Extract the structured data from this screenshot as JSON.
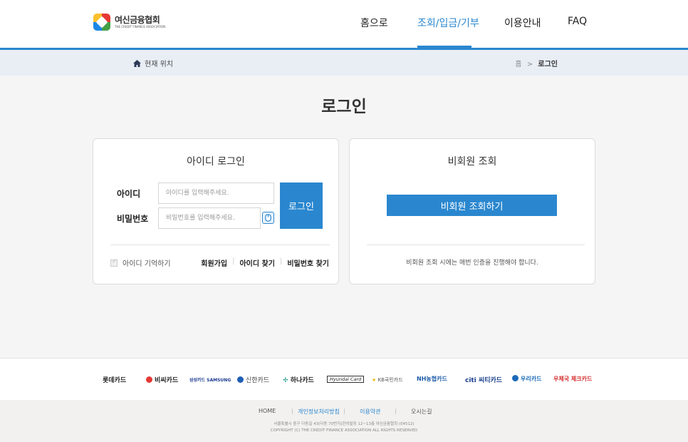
{
  "header": {
    "logo_ko": "여신금융협회",
    "logo_en": "THE CREDIT FINANCE ASSOCIATION",
    "nav": [
      "홈으로",
      "조회/입금/기부",
      "이용안내",
      "FAQ"
    ],
    "active_nav": "조회/입금/기부"
  },
  "breadcrumb": {
    "location_label": "현재 위치",
    "home": "홈",
    "separator": ">",
    "current": "로그인"
  },
  "page": {
    "title": "로그인"
  },
  "id_login": {
    "title": "아이디 로그인",
    "id_label": "아이디",
    "id_placeholder": "아이디를 입력해주세요.",
    "pw_label": "비밀번호",
    "pw_placeholder": "비밀번호를 입력해주세요.",
    "login_button": "로그인",
    "remember_label": "아이디 기억하기",
    "links": [
      "회원가입",
      "아이디 찾기",
      "비밀번호 찾기"
    ]
  },
  "guest": {
    "title": "비회원 조회",
    "button": "비회원 조회하기",
    "note": "비회원 조회 시에는 매번 인증을 진행해야 합니다."
  },
  "partners": [
    "롯데카드",
    "비씨카드",
    "삼성카드 SAMSUNG",
    "신한카드",
    "하나카드",
    "Hyundai Card",
    "KB국민카드",
    "NH농협카드",
    "citi 씨티카드",
    "우리카드",
    "우체국 체크카드"
  ],
  "footer": {
    "links": [
      "HOME",
      "개인정보처리방침",
      "이용약관",
      "오시는길"
    ],
    "address": "서울특별시 중구 다동길 43(다동 70번지)한외빌딩 12~13층 여신금융협회 (04512)",
    "copyright": "COPYRIGHT (C) THE CREDIT FINANCE ASSOCIATION ALL RIGHTS RESERVED"
  },
  "colors": {
    "accent": "#2a87cf",
    "background": "#f5f5f5",
    "crumbbar": "#e9eef5"
  }
}
